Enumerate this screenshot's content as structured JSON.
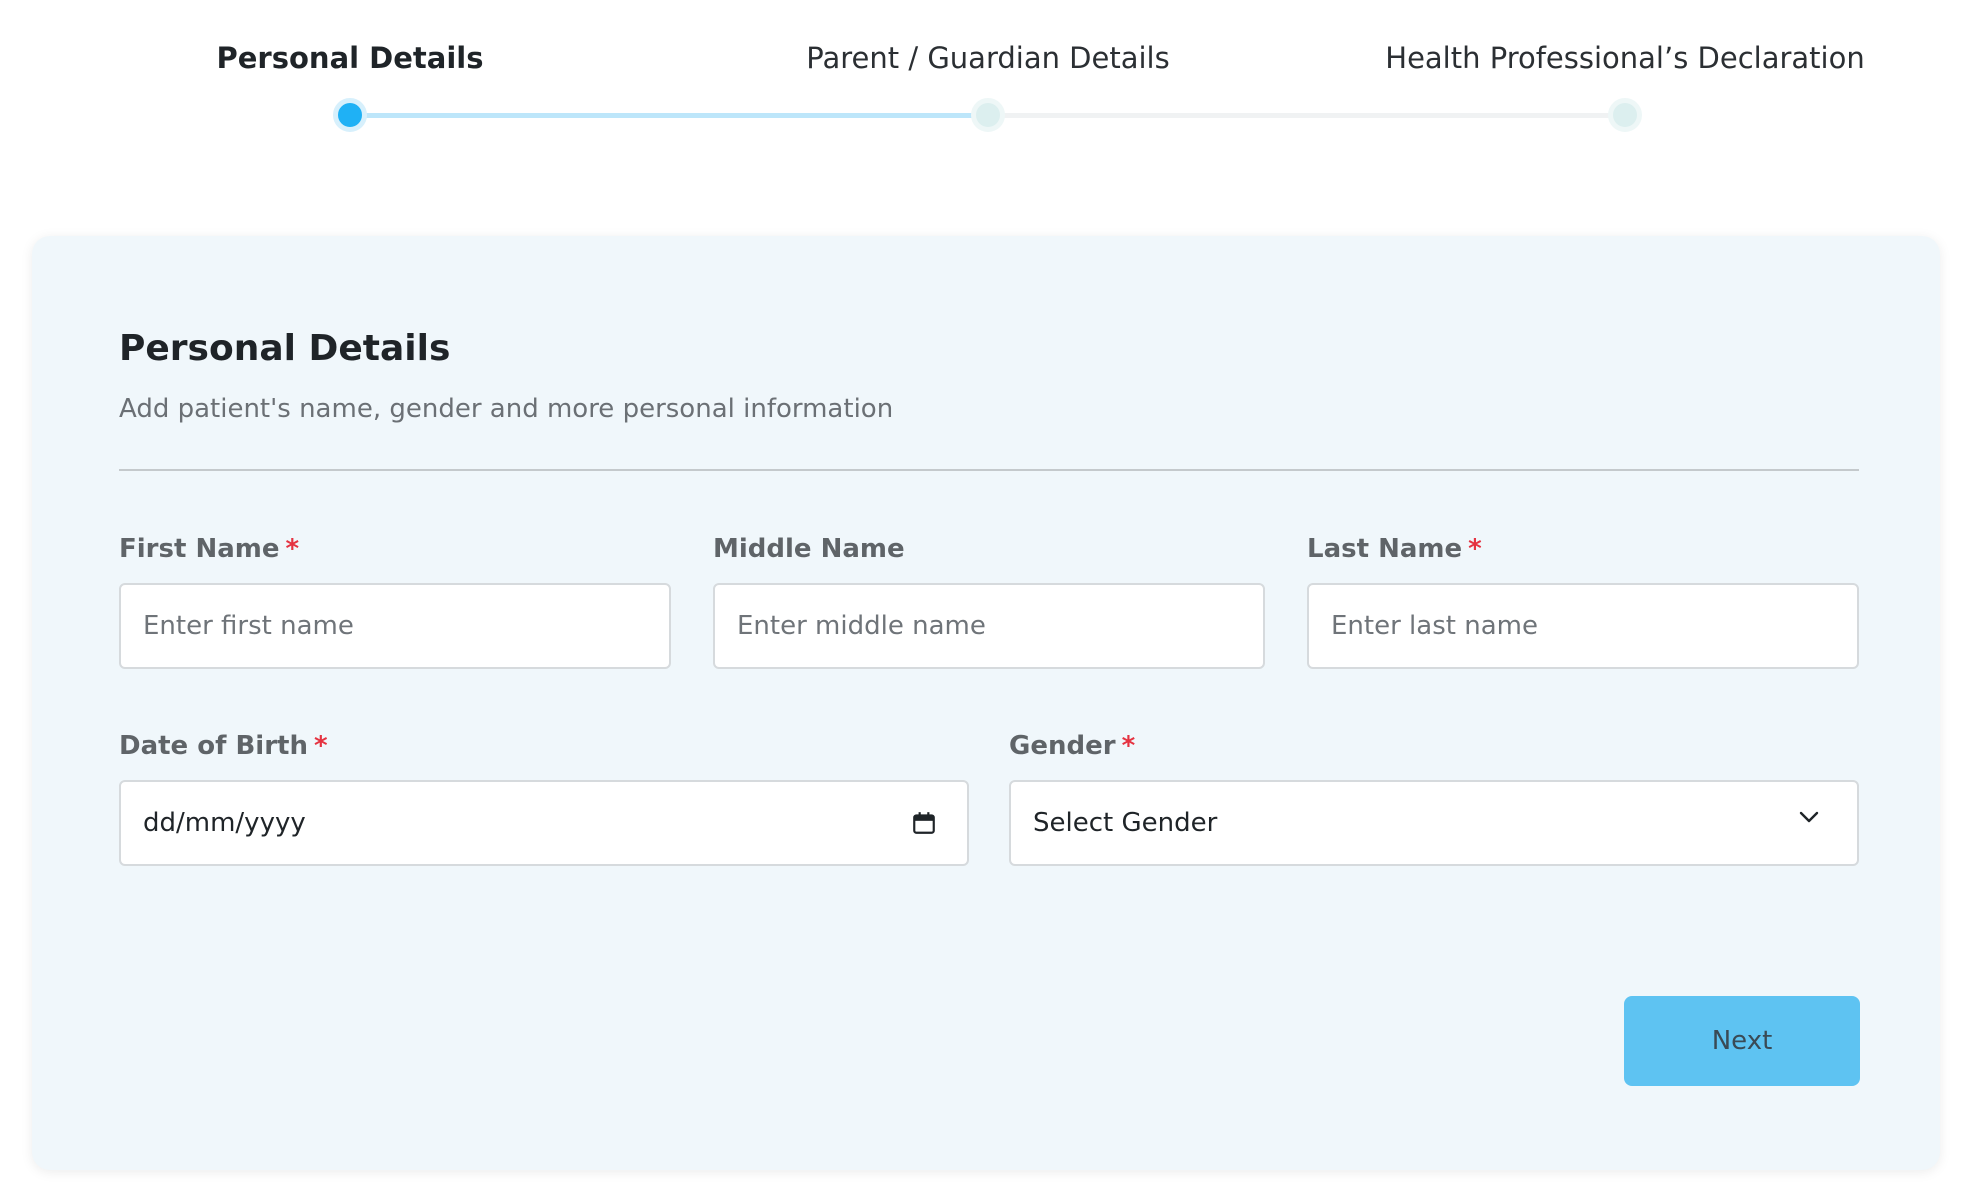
{
  "stepper": {
    "steps": [
      {
        "label": "Personal Details",
        "state": "active"
      },
      {
        "label": "Parent / Guardian Details",
        "state": "pending"
      },
      {
        "label": "Health Professional’s Declaration",
        "state": "pending"
      }
    ]
  },
  "form": {
    "title": "Personal Details",
    "subtitle": "Add patient's name, gender and more personal information",
    "fields": {
      "first_name": {
        "label": "First Name",
        "required_mark": "*",
        "placeholder": "Enter first name",
        "value": ""
      },
      "middle_name": {
        "label": "Middle Name",
        "placeholder": "Enter middle name",
        "value": ""
      },
      "last_name": {
        "label": "Last Name",
        "required_mark": "*",
        "placeholder": "Enter last name",
        "value": ""
      },
      "dob": {
        "label": "Date of Birth",
        "required_mark": "*",
        "value": "dd/mm/yyyy",
        "icon": "calendar-icon"
      },
      "gender": {
        "label": "Gender",
        "required_mark": "*",
        "selected": "Select Gender",
        "icon": "chevron-down-icon"
      }
    },
    "next_label": "Next"
  },
  "colors": {
    "accent": "#1fb1f5",
    "button": "#5ec3f2",
    "card_bg": "#f0f7fb",
    "required": "#e53341"
  }
}
